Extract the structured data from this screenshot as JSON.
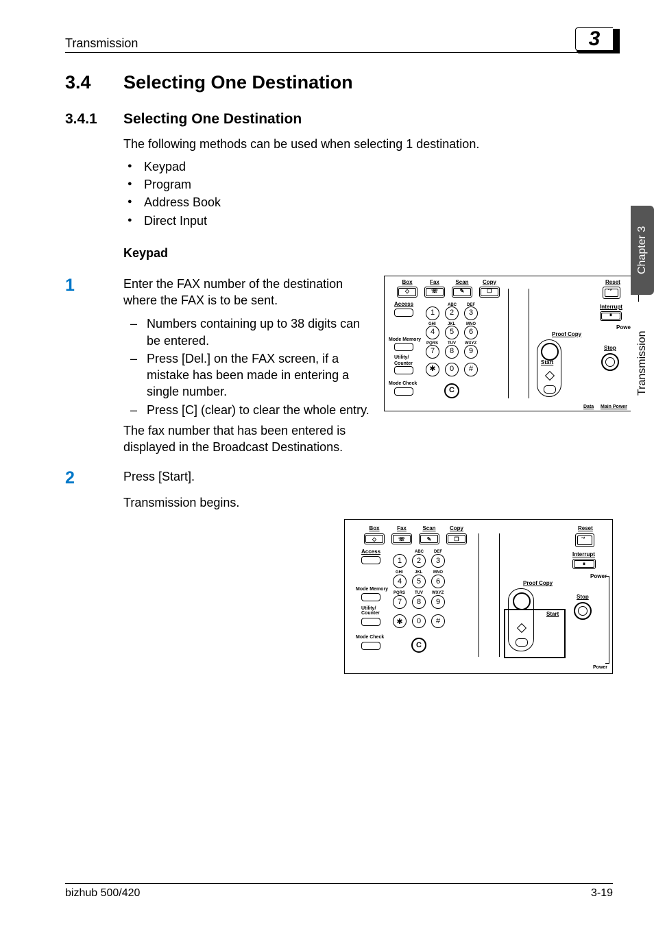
{
  "header": {
    "running": "Transmission",
    "chapter_badge": "3"
  },
  "section": {
    "num": "3.4",
    "title": "Selecting One Destination"
  },
  "subsection": {
    "num": "3.4.1",
    "title": "Selecting One Destination"
  },
  "intro": "The following methods can be used when selecting 1 destination.",
  "bullets": [
    "Keypad",
    "Program",
    "Address Book",
    "Direct Input"
  ],
  "keypad_heading": "Keypad",
  "step1": {
    "num": "1",
    "lead": "Enter the FAX number of the destination where the FAX is to be sent.",
    "dashes": [
      "Numbers containing up to 38 digits can be entered.",
      "Press [Del.] on the FAX screen, if a mistake has been made in entering a single number.",
      "Press [C] (clear) to clear the whole entry."
    ],
    "after": "The fax number that has been entered is displayed in the Broadcast Destinations."
  },
  "step2": {
    "num": "2",
    "lead": "Press [Start].",
    "after": "Transmission begins."
  },
  "panel": {
    "modes": {
      "box": "Box",
      "fax": "Fax",
      "scan": "Scan",
      "copy": "Copy"
    },
    "access": "Access",
    "mode_memory": "Mode Memory",
    "utility": "Utility/\nCounter",
    "mode_check": "Mode Check",
    "reset": "Reset",
    "interrupt": "Interrupt",
    "power": "Power",
    "proof": "Proof Copy",
    "stop": "Stop",
    "start": "Start",
    "data": "Data",
    "mainpower": "Main Power",
    "abc": "ABC",
    "def": "DEF",
    "ghi": "GHI",
    "jkl": "JKL",
    "mno": "MNO",
    "pqrs": "PQRS",
    "tuv": "TUV",
    "wxyz": "WXYZ",
    "k1": "1",
    "k2": "2",
    "k3": "3",
    "k4": "4",
    "k5": "5",
    "k6": "6",
    "k7": "7",
    "k8": "8",
    "k9": "9",
    "k0": "0",
    "kstar": "✱",
    "khash": "#",
    "kc": "C"
  },
  "side": {
    "chapter": "Chapter 3",
    "section": "Transmission"
  },
  "footer": {
    "left": "bizhub 500/420",
    "right": "3-19"
  }
}
